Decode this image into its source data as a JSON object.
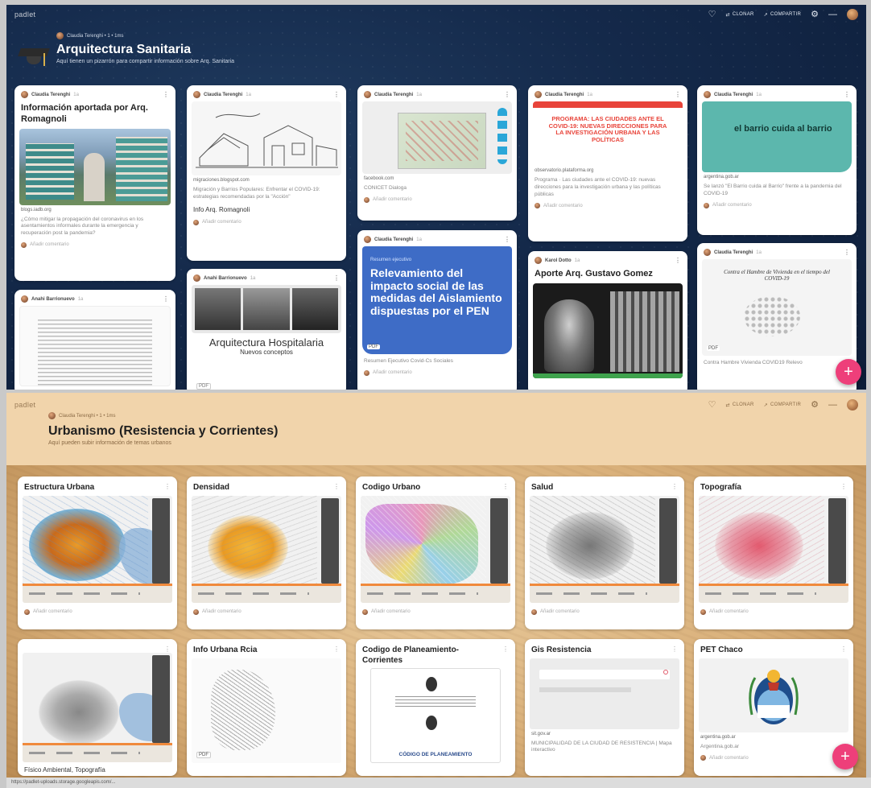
{
  "window1": {
    "brand": "padlet",
    "actions": {
      "remix": "CLONAR",
      "share": "COMPARTIR"
    },
    "author_line": "Claudia Terenghi • 1 • 1ms",
    "title": "Arquitectura Sanitaria",
    "subtitle": "Aquí tienen un pizarrón para compartir información sobre Arq. Sanitaria",
    "cards": [
      {
        "author": "Claudia Terenghi",
        "time": "1a",
        "title": "Información aportada por Arq. Romagnoli",
        "source": "blogs.iadb.org",
        "desc": "¿Cómo mitigar la propagación del coronavirus en los asentamientos informales durante la emergencia y recuperación post la pandemia?",
        "comment": "Añadir comentario"
      },
      {
        "author": "Claudia Terenghi",
        "time": "1a",
        "source": "migraciones.blogspot.com",
        "desc": "Migración y Barrios Populares: Enfrentar el COVID-19: estrategias recomendadas por la \"Acción\"",
        "strong": "Info Arq. Romagnoli",
        "comment": "Añadir comentario"
      },
      {
        "author": "Claudia Terenghi",
        "time": "1a",
        "source": "facebook.com",
        "desc": "CONICET Dialoga",
        "comment": "Añadir comentario"
      },
      {
        "author": "Claudia Terenghi",
        "time": "1a",
        "banner": "PROGRAMA: LAS CIUDADES ANTE EL COVID-19: NUEVAS DIRECCIONES PARA LA INVESTIGACIÓN URBANA Y LAS POLÍTICAS",
        "source": "observatorio.plataforma.org",
        "desc": "Programa · Las ciudades ante el COVID-19: nuevas direcciones para la investigación urbana y las políticas públicas",
        "comment": "Añadir comentario"
      },
      {
        "author": "Claudia Terenghi",
        "time": "1a",
        "banner": "el barrio cuida al barrio",
        "source": "argentina.gob.ar",
        "desc": "Se lanzó \"El Barrio cuida al Barrio\" frente a la pandemia del COVID-19",
        "comment": "Añadir comentario"
      },
      {
        "author": "Anahi Barrionuevo",
        "time": "1a"
      },
      {
        "author": "Anahi Barrionuevo",
        "time": "1a",
        "doc_title": "Arquitectura Hospitalaria",
        "doc_sub": "Nuevos conceptos",
        "badge": "PDF"
      },
      {
        "author": "Claudia Terenghi",
        "time": "1a",
        "kicker": "Resumen ejecutivo",
        "headline": "Relevamiento del impacto social de las medidas del Aislamiento dispuestas por el PEN",
        "badge": "PDF",
        "desc": "Resumen Ejecutivo Covid-Cs Sociales",
        "comment": "Añadir comentario"
      },
      {
        "author": "Karol Dotto",
        "time": "1a",
        "title": "Aporte Arq. Gustavo Gomez"
      },
      {
        "author": "Claudia Terenghi",
        "time": "1a",
        "doc_title": "Contra el Hambre de Vivienda en el tiempo del COVID-19",
        "badge": "PDF",
        "desc": "Contra Hambre Vivienda COVID19 Relevo"
      }
    ]
  },
  "window2": {
    "brand": "padlet",
    "actions": {
      "remix": "CLONAR",
      "share": "COMPARTIR"
    },
    "author_line": "Claudia Terenghi • 1 • 1ms",
    "title": "Urbanismo (Resistencia y Corrientes)",
    "subtitle": "Aquí pueden subir información de temas urbanos",
    "row1": [
      {
        "title": "Estructura Urbana",
        "comment": "Añadir comentario"
      },
      {
        "title": "Densidad",
        "comment": "Añadir comentario"
      },
      {
        "title": "Codigo Urbano",
        "comment": "Añadir comentario"
      },
      {
        "title": "Salud",
        "comment": "Añadir comentario"
      },
      {
        "title": "Topografía",
        "comment": "Añadir comentario"
      }
    ],
    "row2": [
      {
        "title": "",
        "caption": "Físico Ambiental, Topografía"
      },
      {
        "title": "Info Urbana Rcia",
        "badge": "PDF"
      },
      {
        "title": "Codigo de Planeamiento-Corrientes",
        "doc_title": "CÓDIGO DE PLANEAMIENTO"
      },
      {
        "title": "Gis Resistencia",
        "source": "sit.gov.ar",
        "desc": "MUNICIPALIDAD DE LA CIUDAD DE RESISTENCIA | Mapa interactivo"
      },
      {
        "title": "PET Chaco",
        "source": "argentina.gob.ar",
        "desc": "Argentina.gob.ar",
        "comment": "Añadir comentario"
      }
    ]
  },
  "status_url": "https://padlet-uploads.storage.googleapis.com/...",
  "colors": {
    "fab": "#ee3f7a",
    "dark_bg": "#14294a",
    "tan_bg": "#e9c89a",
    "map_orange": "#f08a3c"
  }
}
